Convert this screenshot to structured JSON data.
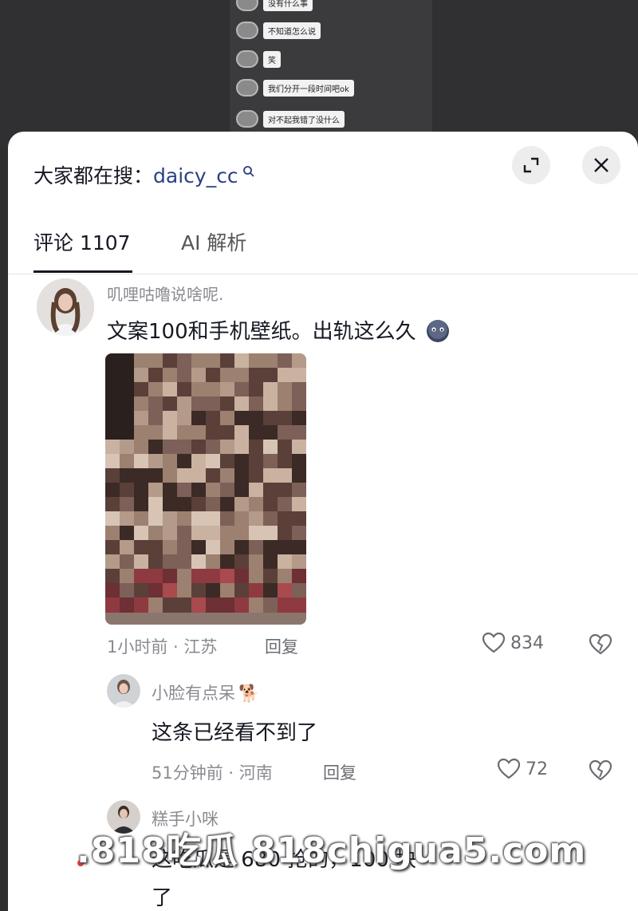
{
  "chat_overlay": {
    "messages": [
      {
        "text": "没有什么事"
      },
      {
        "text": "不知道怎么说"
      },
      {
        "text": "笑"
      },
      {
        "text": "我们分开一段时间吧ok"
      },
      {
        "text": "对不起我错了没什么"
      }
    ]
  },
  "header": {
    "search_prefix": "大家都在搜：",
    "search_keyword": "daicy_cc",
    "search_icon": "search-icon",
    "expand_icon": "expand-icon",
    "close_icon": "close-icon"
  },
  "tabs": [
    {
      "label": "评论 1107",
      "active": true
    },
    {
      "label": "AI 解析",
      "active": false
    }
  ],
  "comments": [
    {
      "username": "叽哩咕噜说啥呢.",
      "text": "文案100和手机壁纸。出轨这么久",
      "emoji": "sad-face-emoji",
      "has_image": true,
      "time_location": "1小时前 · 江苏",
      "reply_label": "回复",
      "likes": "834"
    },
    {
      "username": "小脸有点呆",
      "username_emoji": "🐕",
      "text": "这条已经看不到了",
      "time_location": "51分钟前 · 河南",
      "reply_label": "回复",
      "likes": "72"
    },
    {
      "username": "糕手小咪",
      "text": "这吃瓜是 680 抢的，100 块",
      "text_cont": "了"
    }
  ],
  "watermark": {
    "text": ".818吃瓜 818chigua5.com"
  },
  "colors": {
    "sheet_bg": "#ffffff",
    "keyword": "#2b3f84",
    "muted": "#8a8b91",
    "dark_bg": "#2e2e30"
  }
}
